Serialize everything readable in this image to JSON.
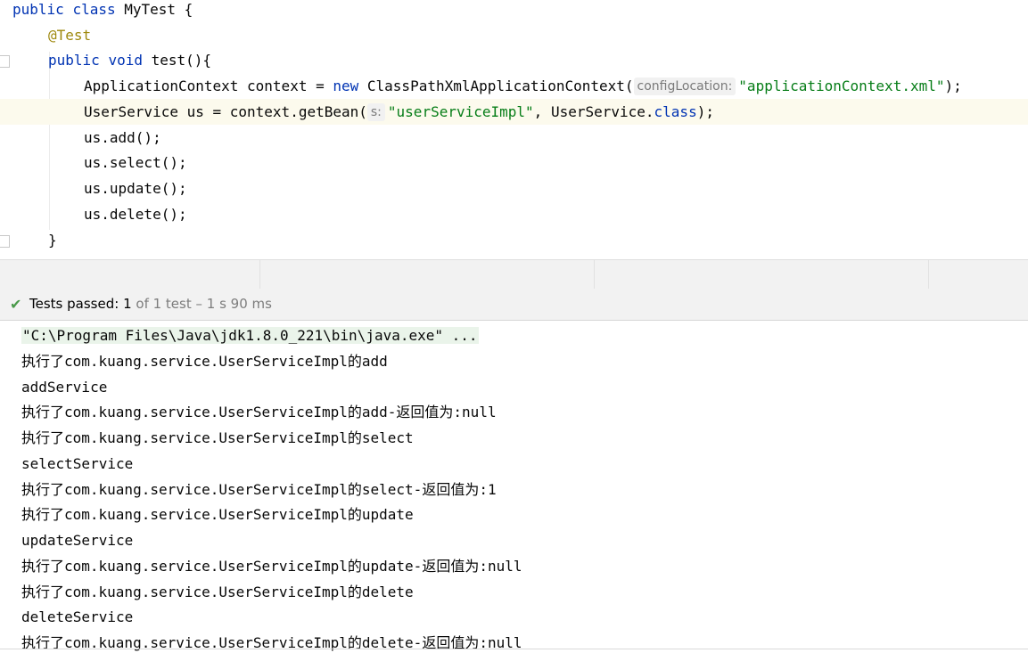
{
  "editor": {
    "kw_public": "public",
    "kw_class": "class",
    "class_name": "MyTest {",
    "annotation": "@Test",
    "kw_void": "void",
    "method_sig": "test(){",
    "line4_a": "ApplicationContext context = ",
    "kw_new": "new",
    "line4_b": " ClassPathXmlApplicationContext(",
    "hint_config": "configLocation:",
    "str_xml": "\"applicationContext.xml\"",
    "line4_end": ");",
    "line5_a": "UserService us = context.getBean(",
    "hint_s": "s:",
    "str_impl": "\"userServiceImpl\"",
    "line5_b": ", UserService.",
    "kw_class2": "class",
    "line5_end": ");",
    "call_add": "us.add();",
    "call_select": "us.select();",
    "call_update": "us.update();",
    "call_delete": "us.delete();",
    "closing_brace": "}"
  },
  "test_status": {
    "label": "Tests passed:",
    "passed": "1",
    "detail": "of 1 test – 1 s 90 ms"
  },
  "console": {
    "command": "\"C:\\Program Files\\Java\\jdk1.8.0_221\\bin\\java.exe\" ...",
    "lines": [
      "执行了com.kuang.service.UserServiceImpl的add",
      "addService",
      "执行了com.kuang.service.UserServiceImpl的add-返回值为:null",
      "执行了com.kuang.service.UserServiceImpl的select",
      "selectService",
      "执行了com.kuang.service.UserServiceImpl的select-返回值为:1",
      "执行了com.kuang.service.UserServiceImpl的update",
      "updateService",
      "执行了com.kuang.service.UserServiceImpl的update-返回值为:null",
      "执行了com.kuang.service.UserServiceImpl的delete",
      "deleteService",
      "执行了com.kuang.service.UserServiceImpl的delete-返回值为:null"
    ]
  },
  "colors": {
    "keyword": "#0033b3",
    "string": "#067d17",
    "annotation": "#9e880d",
    "pass_check": "#4a9a4a"
  }
}
